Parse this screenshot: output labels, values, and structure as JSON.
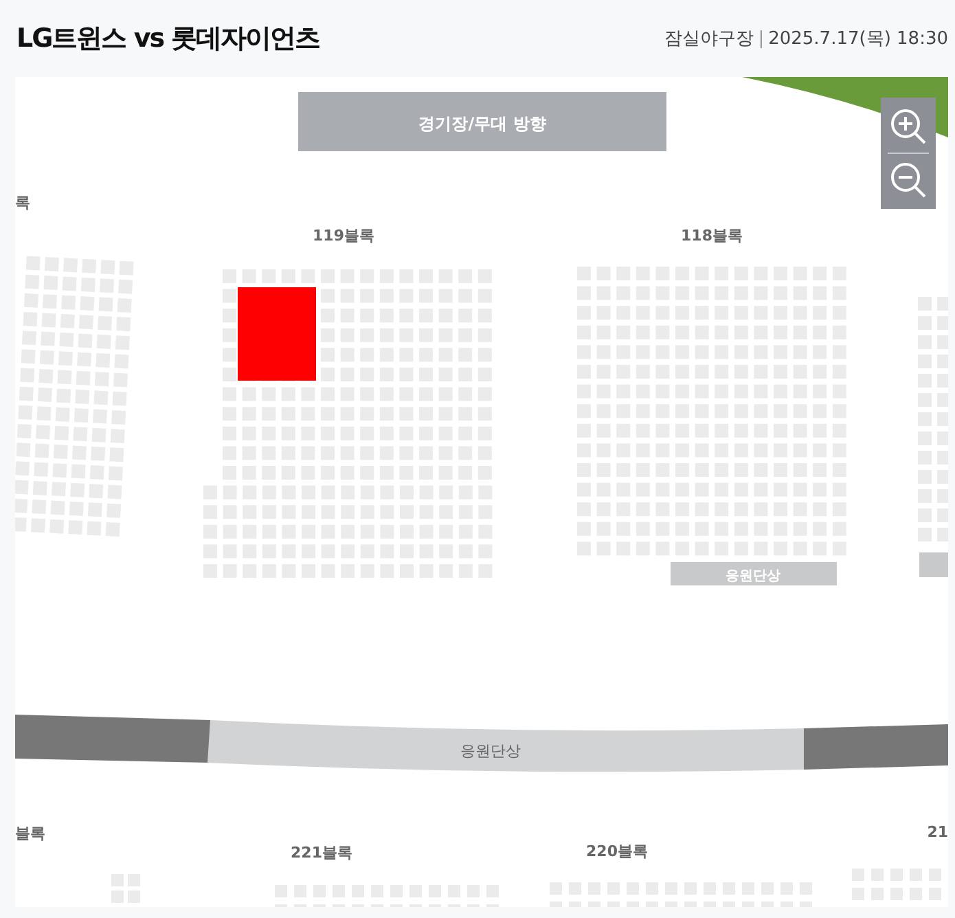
{
  "header": {
    "title": "LG트윈스 vs 롯데자이언츠",
    "venue": "잠실야구장",
    "separator": "|",
    "datetime": "2025.7.17(목) 18:30"
  },
  "map": {
    "stage_label": "경기장/무대 방향",
    "zoom_controls": [
      {
        "kind": "zoom-in"
      },
      {
        "kind": "zoom-out"
      }
    ],
    "blocks": [
      {
        "label": "록",
        "selected": false
      },
      {
        "label": "119블록",
        "selected": true
      },
      {
        "label": "118블록",
        "selected": false
      },
      {
        "label": "블록",
        "selected": false
      },
      {
        "label": "221블록",
        "selected": false
      },
      {
        "label": "220블록",
        "selected": false
      },
      {
        "label": "21",
        "selected": false
      }
    ],
    "cheer_stages": [
      {
        "label": "응원단상"
      },
      {
        "label": "응원단상"
      }
    ]
  }
}
